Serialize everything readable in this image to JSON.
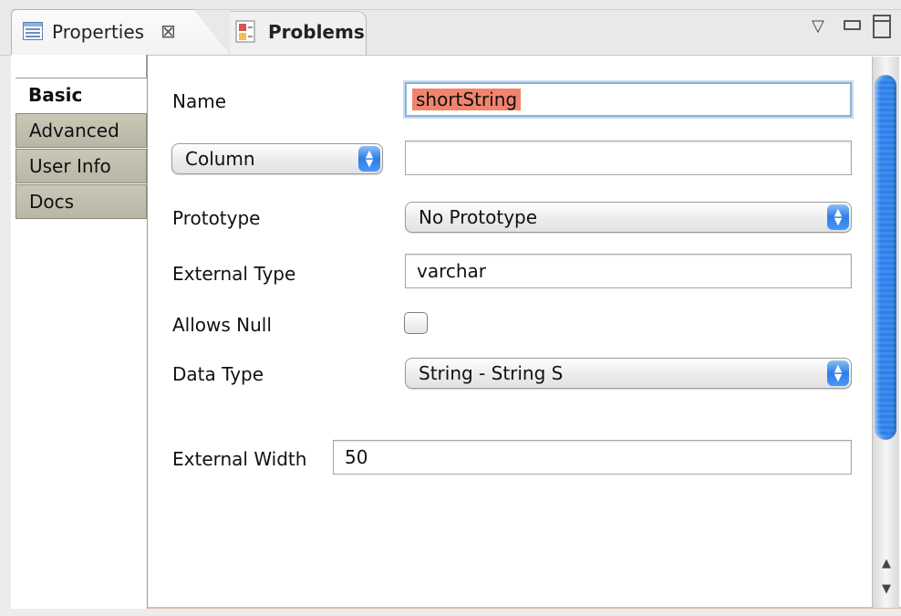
{
  "tabs": {
    "properties_label": "Properties",
    "close_glyph": "⊠",
    "problems_label": "Problems"
  },
  "view_controls": {
    "menu_glyph": "▽"
  },
  "nav": {
    "items": [
      {
        "label": "Basic",
        "active": true
      },
      {
        "label": "Advanced",
        "active": false
      },
      {
        "label": "User Info",
        "active": false
      },
      {
        "label": "Docs",
        "active": false
      }
    ]
  },
  "form": {
    "name_label": "Name",
    "name_value": "shortString",
    "column_popup": "Column",
    "column_field_value": "",
    "prototype_label": "Prototype",
    "prototype_value": "No Prototype",
    "external_type_label": "External Type",
    "external_type_value": "varchar",
    "allows_null_label": "Allows Null",
    "allows_null_checked": false,
    "data_type_label": "Data Type",
    "data_type_value": "String - String S",
    "external_width_label": "External Width",
    "external_width_value": "50"
  },
  "scrollbar": {
    "up_glyph": "▲",
    "down_glyph": "▼"
  },
  "colors": {
    "selection_highlight": "#f2846d",
    "panel_border": "#e6b9ad",
    "scroll_thumb": "#2f7fe6"
  }
}
